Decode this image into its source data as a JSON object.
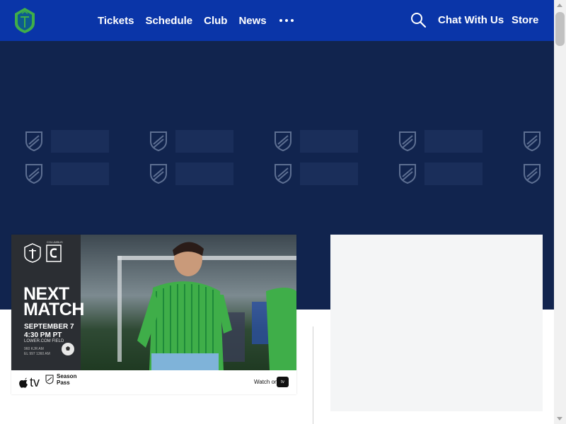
{
  "header": {
    "logo_icon": "sounders-crest-icon",
    "nav": [
      "Tickets",
      "Schedule",
      "Club",
      "News"
    ],
    "more_icon": "more-dots-icon",
    "search_icon": "search-icon",
    "chat_label": "Chat With Us",
    "store_label": "Store"
  },
  "match_card": {
    "title_line1": "NEXT",
    "title_line2": "MATCH",
    "date": "SEPTEMBER 7",
    "time": "4:30 PM PT",
    "venue": "LOWER.COM FIELD",
    "broadcast_line1": "960 KJR AM",
    "broadcast_line2": "EL 997 1360 AM",
    "opponent_label": "COLUMBUS",
    "apple_tv": "tv",
    "season_pass_line1": "Season",
    "season_pass_line2": "Pass",
    "watch_on": "Watch on",
    "tv_badge": "tv"
  },
  "colors": {
    "header_bg": "#0a35a8",
    "hero_bg": "#11244e",
    "accent_green": "#3fae49",
    "card_panel": "#2b2e33"
  }
}
